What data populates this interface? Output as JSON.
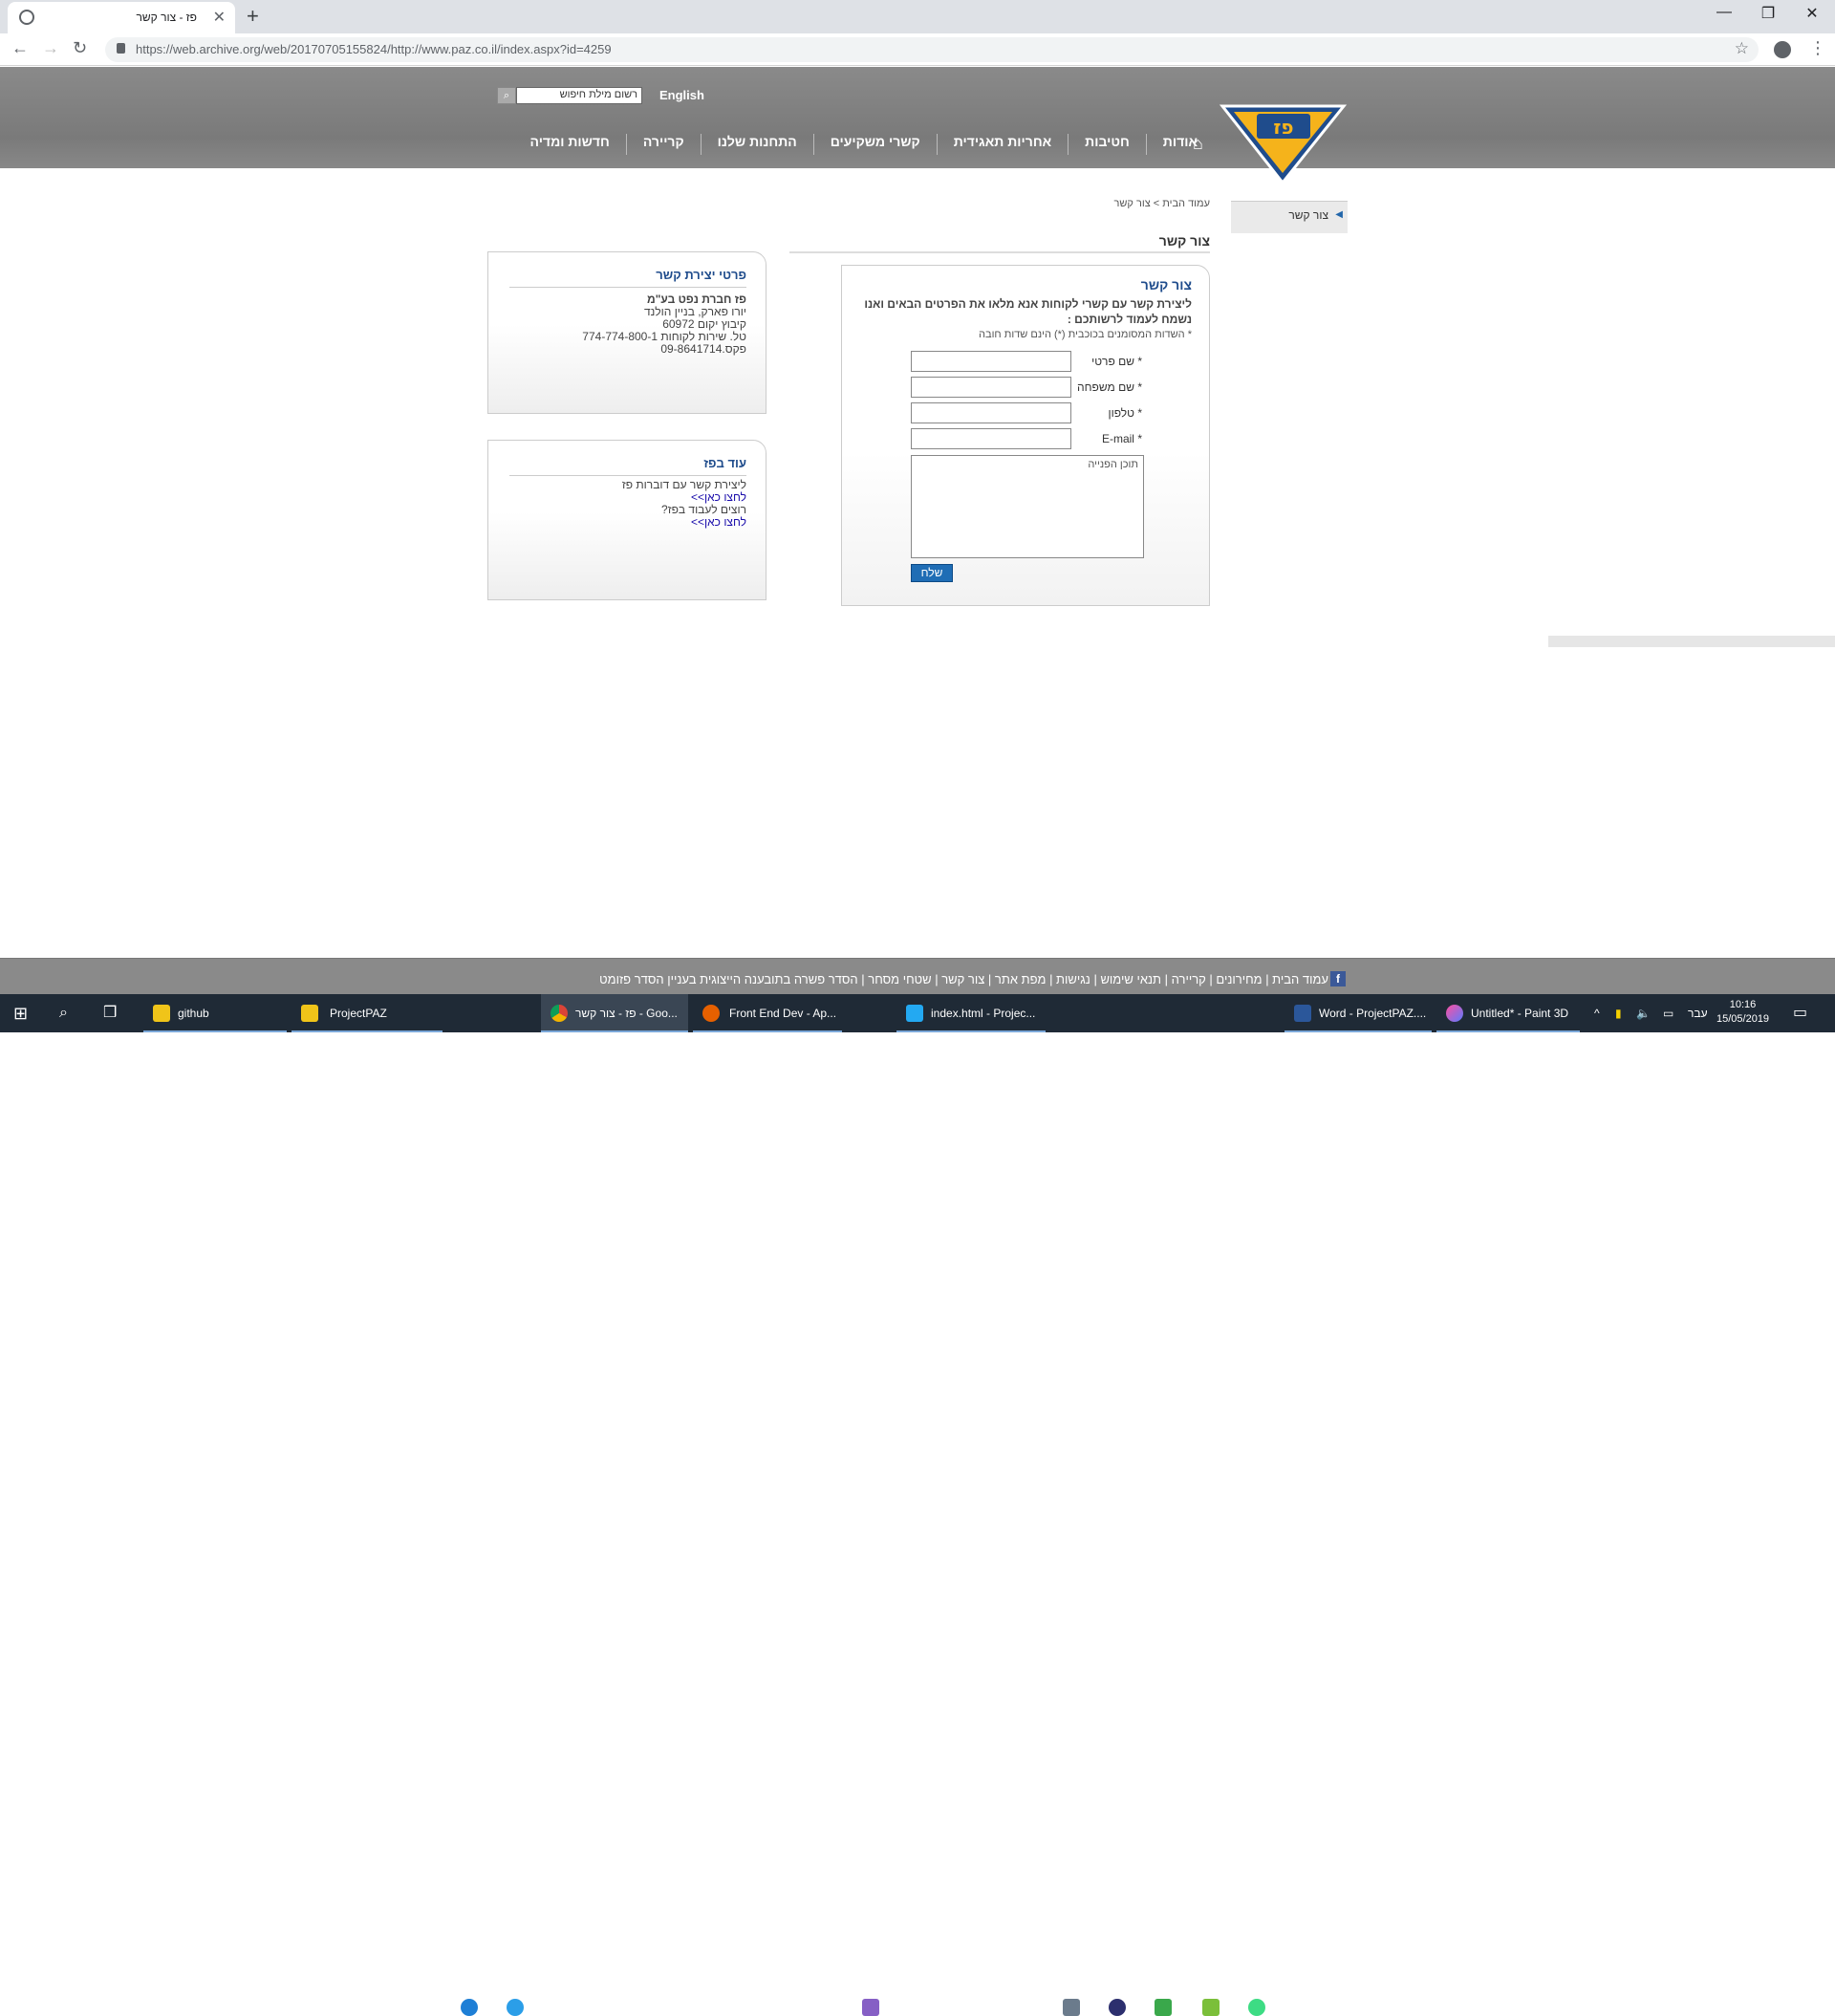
{
  "browser": {
    "tab_title": "פז - צור קשר",
    "url": "https://web.archive.org/web/20170705155824/http://www.paz.co.il/index.aspx?id=4259",
    "window_buttons": {
      "minimize": "—",
      "restore": "❐",
      "close": "✕"
    }
  },
  "site": {
    "logo_text": "פז",
    "lang_link": "English",
    "search_placeholder": "רשום מילת חיפוש",
    "nav": [
      "אודות",
      "חטיבות",
      "אחריות תאגידית",
      "קשרי משקיעים",
      "התחנות שלנו",
      "קריירה",
      "חדשות ומדיה"
    ],
    "sidebar_item": "צור קשר",
    "breadcrumb": "עמוד הבית > צור קשר",
    "page_title": "צור קשר"
  },
  "form": {
    "title": "צור קשר",
    "intro": "ליצירת קשר עם קשרי לקוחות אנא מלאו את הפרטים הבאים ואנו נשמח לעמוד לרשותכם :",
    "required_note": "* השדות המסומנים בכוכבית (*) הינם שדות חובה",
    "fields": {
      "first_name": "* שם פרטי",
      "last_name": "* שם משפחה",
      "phone": "* טלפון",
      "email": "* E-mail"
    },
    "content_placeholder": "תוכן הפנייה",
    "submit": "שלח"
  },
  "contact_box": {
    "title": "פרטי יצירת קשר",
    "lines": [
      "פז חברת נפט בע\"מ",
      "יורו פארק, בניין הולנד",
      "קיבוץ יקום 60972",
      "טל. שירות לקוחות 774-774-800-1",
      "פקס.09-8641714"
    ]
  },
  "more_box": {
    "title": "עוד בפז",
    "line1": "ליצירת קשר עם דוברות פז",
    "link1": "לחצו כאן>>",
    "line2": "רוצים לעבוד בפז?",
    "link2": "לחצו כאן>>"
  },
  "footer": {
    "links": "עמוד הבית | מחירונים | קריירה | תנאי שימוש | נגישות | מפת אתר | צור קשר | שטחי מסחר | הסדר פשרה בתובענה הייצוגית בעניין הסדר פזומט"
  },
  "taskbar": {
    "items": [
      "github",
      "ProjectPAZ",
      "פז - צור קשר - Goo...",
      "Front End Dev - Ap...",
      "index.html - Projec...",
      "Word - ProjectPAZ....",
      "Untitled* - Paint 3D"
    ],
    "lang": "עבר",
    "time": "10:16",
    "date": "15/05/2019"
  },
  "colors": {
    "accent_blue": "#1f4c8c",
    "header_gray": "#8a8a8a",
    "logo_yellow": "#f5b31b"
  }
}
